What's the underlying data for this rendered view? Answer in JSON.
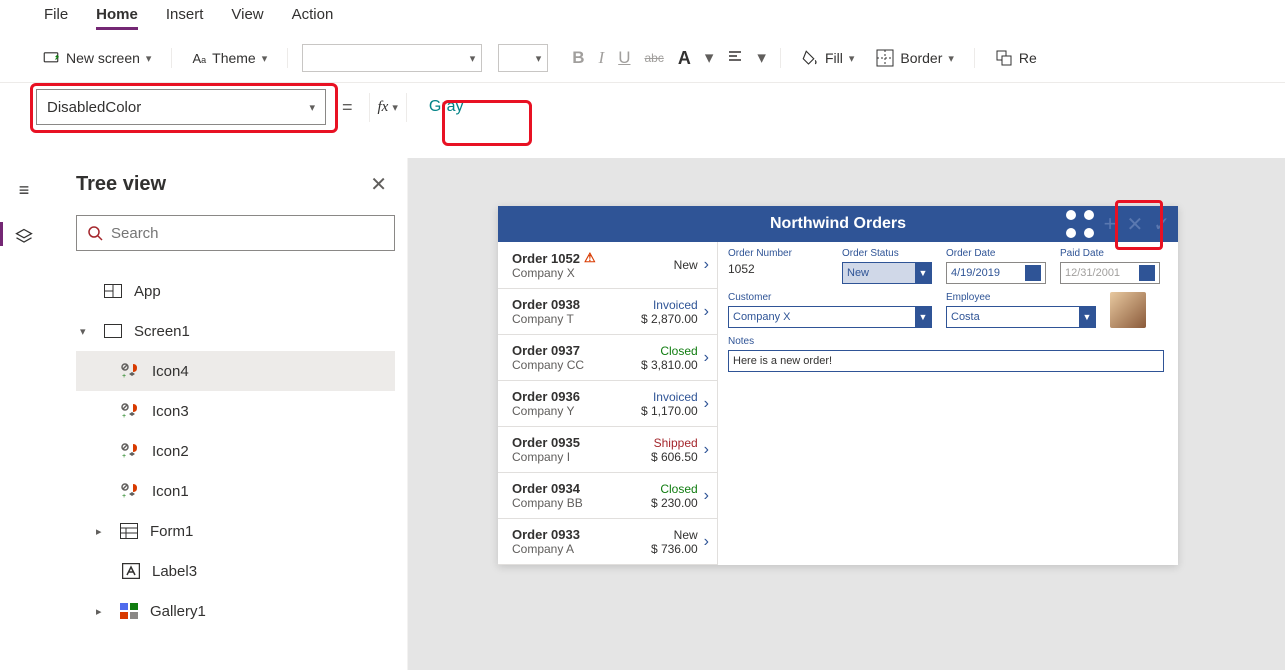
{
  "menu": {
    "file": "File",
    "home": "Home",
    "insert": "Insert",
    "view": "View",
    "action": "Action"
  },
  "toolbar": {
    "new_screen": "New screen",
    "theme": "Theme",
    "fill": "Fill",
    "border": "Border",
    "reorder": "Re",
    "bold": "B",
    "italic": "I",
    "underline": "U",
    "strike": "abc",
    "fontcolor": "A",
    "align": "≡"
  },
  "formula": {
    "property": "DisabledColor",
    "value": "Gray"
  },
  "tree": {
    "title": "Tree view",
    "search_ph": "Search",
    "nodes": {
      "app": "App",
      "screen": "Screen1",
      "icon4": "Icon4",
      "icon3": "Icon3",
      "icon2": "Icon2",
      "icon1": "Icon1",
      "form": "Form1",
      "label": "Label3",
      "gallery": "Gallery1"
    }
  },
  "app": {
    "title": "Northwind Orders",
    "orders": [
      {
        "name": "Order 1052",
        "company": "Company X",
        "status": "New",
        "amount": "",
        "warn": true
      },
      {
        "name": "Order 0938",
        "company": "Company T",
        "status": "Invoiced",
        "amount": "$ 2,870.00"
      },
      {
        "name": "Order 0937",
        "company": "Company CC",
        "status": "Closed",
        "amount": "$ 3,810.00"
      },
      {
        "name": "Order 0936",
        "company": "Company Y",
        "status": "Invoiced",
        "amount": "$ 1,170.00"
      },
      {
        "name": "Order 0935",
        "company": "Company I",
        "status": "Shipped",
        "amount": "$ 606.50"
      },
      {
        "name": "Order 0934",
        "company": "Company BB",
        "status": "Closed",
        "amount": "$ 230.00"
      },
      {
        "name": "Order 0933",
        "company": "Company A",
        "status": "New",
        "amount": "$ 736.00"
      }
    ],
    "form": {
      "order_number_lbl": "Order Number",
      "order_number": "1052",
      "order_status_lbl": "Order Status",
      "order_status": "New",
      "order_date_lbl": "Order Date",
      "order_date": "4/19/2019",
      "paid_date_lbl": "Paid Date",
      "paid_date": "12/31/2001",
      "customer_lbl": "Customer",
      "customer": "Company X",
      "employee_lbl": "Employee",
      "employee": "Costa",
      "notes_lbl": "Notes",
      "notes": "Here is a new order!"
    }
  }
}
